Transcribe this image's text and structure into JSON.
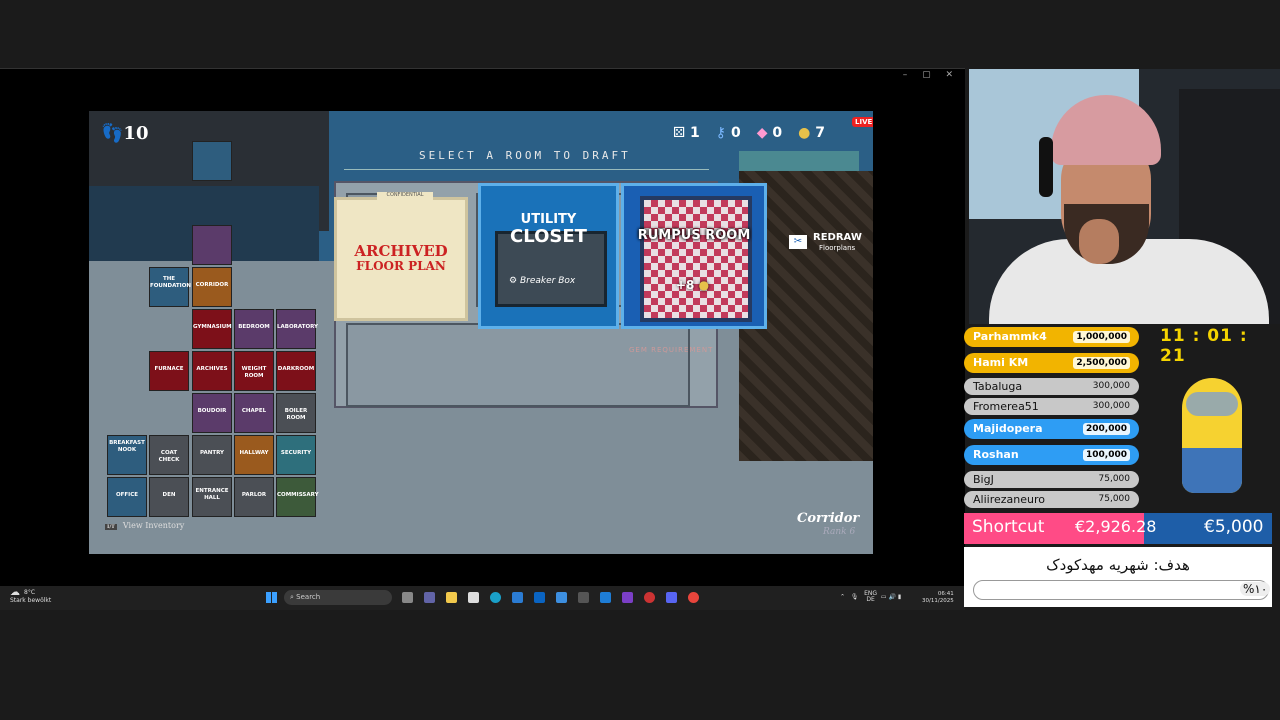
{
  "game": {
    "steps": "10",
    "resources": {
      "dice": "1",
      "keys": "0",
      "gems": "0",
      "coins": "7"
    },
    "live_badge": "LIVE",
    "select_title": "SELECT A ROOM TO DRAFT",
    "cards": {
      "archived": {
        "tab": "CONFIDENTIAL",
        "line1": "ARCHIVED",
        "line2": "FLOOR PLAN"
      },
      "utility": {
        "line1": "UTILITY",
        "line2": "CLOSET",
        "sub": "Breaker Box"
      },
      "rumpus": {
        "line1": "RUMPUS ROOM",
        "bonus": "+8"
      }
    },
    "redraw": {
      "line1": "REDRAW",
      "line2": "Floorplans"
    },
    "gem_requirement": "GEM REQUIREMENT",
    "room_name": "Corridor",
    "rank": "Rank 6",
    "minimap": {
      "foundation": "THE FOUNDATION",
      "corridor": "CORRIDOR",
      "gymnasium": "GYMNASIUM",
      "bedroom": "BEDROOM",
      "laboratory": "LABORATORY",
      "furnace": "FURNACE",
      "archives": "ARCHIVES",
      "weight_room": "WEIGHT ROOM",
      "darkroom": "DARKROOM",
      "boudoir": "BOUDOIR",
      "chapel": "CHAPEL",
      "boiler_room": "BOILER ROOM",
      "breakfast_nook": "BREAKFAST NOOK",
      "coat_check": "COAT CHECK",
      "pantry": "PANTRY",
      "hallway": "HALLWAY",
      "security": "SECURITY",
      "office": "OFFICE",
      "den": "DEN",
      "entrance_hall": "ENTRANCE HALL",
      "parlor": "PARLOR",
      "commissary": "COMMISSARY"
    },
    "view_inventory_key": "I/T",
    "view_inventory": "View Inventory"
  },
  "taskbar": {
    "weather_temp": "8°C",
    "weather_desc": "Stark bewölkt",
    "search": "Search",
    "lang1": "ENG",
    "lang2": "DE",
    "time": "06:41",
    "date": "30/11/2025"
  },
  "donations": [
    {
      "name": "Parhammk4",
      "amount": "1,000,000"
    },
    {
      "name": "Hami KM",
      "amount": "2,500,000"
    },
    {
      "name": "Tabaluga",
      "amount": "300,000"
    },
    {
      "name": "Fromerea51",
      "amount": "300,000"
    },
    {
      "name": "Majidopera",
      "amount": "200,000"
    },
    {
      "name": "Roshan",
      "amount": "100,000"
    },
    {
      "name": "BigJ",
      "amount": "75,000"
    },
    {
      "name": "Aliirezaneuro",
      "amount": "75,000"
    }
  ],
  "timer": "11 : 01 : 21",
  "shortcut": {
    "label": "Shortcut",
    "current": "€2,926.28",
    "goal": "€5,000",
    "progress": 0.585
  },
  "goal": {
    "text": "هدف: شهریه مهدکودک",
    "percent": "%١٠"
  },
  "colors": {
    "gold": "#f2b400",
    "blue": "#2e9df4",
    "pink": "#ff4b86",
    "navy": "#1e5ea8"
  }
}
